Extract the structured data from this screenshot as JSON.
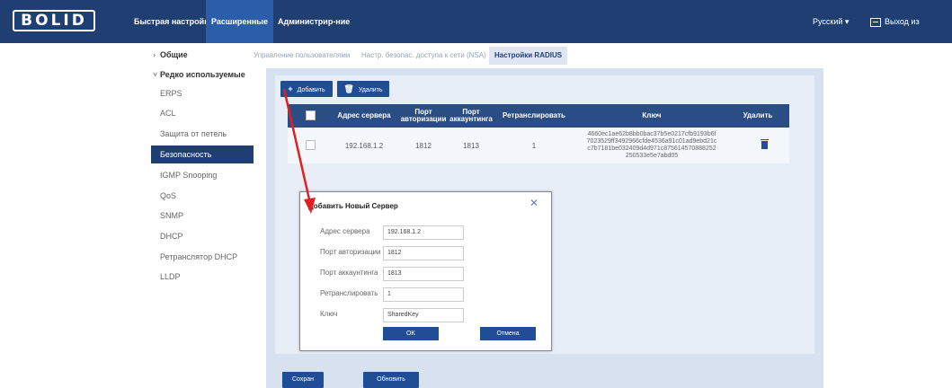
{
  "header": {
    "logo": "BOLID",
    "nav": [
      "Быстрая настройка",
      "Расширенные",
      "Администрир-ние"
    ],
    "language": "Русский",
    "logout": "Выход из системы"
  },
  "sidebar": {
    "group_general": "Общие",
    "group_rare": "Редко используемые",
    "items": [
      "ERPS",
      "ACL",
      "Защита от петель",
      "Безопасность",
      "IGMP Snooping",
      "QoS",
      "SNMP",
      "DHCP",
      "Ретранслятор DHCP",
      "LLDP"
    ]
  },
  "tabs": [
    "Управление пользователями",
    "Настр. безопас. доступа к сети (NSA)",
    "Настройки RADIUS"
  ],
  "toolbar": {
    "add": "Добавить",
    "delete": "Удалить"
  },
  "table": {
    "headers": [
      "Адрес сервера",
      "Порт авторизации",
      "Порт аккаунтинга",
      "Ретранслировать",
      "Ключ",
      "Удалить"
    ],
    "rows": [
      {
        "address": "192.168.1.2",
        "auth_port": "1812",
        "acct_port": "1813",
        "retransmit": "1",
        "key_lines": [
          "4660ec1ae62b8bb0bac37b5e0217cfb9193b6f",
          "7023529ff3492966cfde4536a91c01ad9ebd21c",
          "c7b7181be032409d4d971c875614570888252",
          "250533e5e7abd05"
        ]
      }
    ]
  },
  "modal": {
    "title": "Добавить Новый Сервер",
    "fields": [
      {
        "label": "Адрес сервера",
        "value": "192.168.1.2"
      },
      {
        "label": "Порт авторизации",
        "value": "1812"
      },
      {
        "label": "Порт аккаунтинга",
        "value": "1813"
      },
      {
        "label": "Ретранслировать",
        "value": "1"
      },
      {
        "label": "Ключ",
        "value": "SharedKey"
      }
    ],
    "ok": "OK",
    "cancel": "Отмена"
  },
  "footer": {
    "save": "Сохран",
    "refresh": "Обновить"
  },
  "colors": {
    "header_bg": "#1f3f73",
    "accent": "#1f4e96",
    "arrow": "#e02020"
  }
}
